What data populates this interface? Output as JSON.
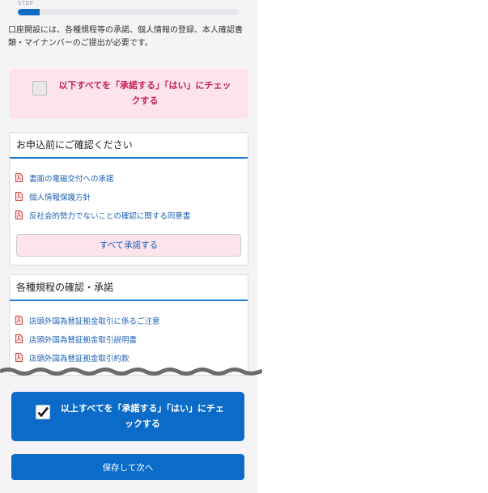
{
  "step": {
    "label": "STEP",
    "progress": 0.1
  },
  "intro_text": "口座開設には、各種規程等の承諾、個人情報の登録、本人確認書類・マイナンバーのご提出が必要です。",
  "check_all_unchecked": {
    "label": "以下すべてを「承諾する」「はい」にチェックする",
    "checked": false
  },
  "before_apply": {
    "title": "お申込前にご確認ください",
    "documents": [
      "書面の電磁交付への承諾",
      "個人情報保護方針",
      "反社会的勢力でないことの確認に関する同意書"
    ],
    "approve_all_label": "すべて承諾する"
  },
  "regulations": {
    "title": "各種規程の確認・承諾",
    "documents": [
      "店頭外国為替証拠金取引に係るご注意",
      "店頭外国為替証拠金取引説明書",
      "店頭外国為替証拠金取引約款"
    ]
  },
  "check_all_checked": {
    "label": "以上すべてを「承諾する」「はい」にチェックする",
    "checked": true
  },
  "save_button_label": "保存して次へ",
  "colors": {
    "primary": "#0a6bc9",
    "pink_bg": "#fde4ec",
    "pink_text": "#c51f5d",
    "link": "#1a5fb4",
    "pdf": "#d93636"
  },
  "icons": {
    "document": "pdf-icon",
    "checkbox_checked": "checkmark-icon"
  }
}
